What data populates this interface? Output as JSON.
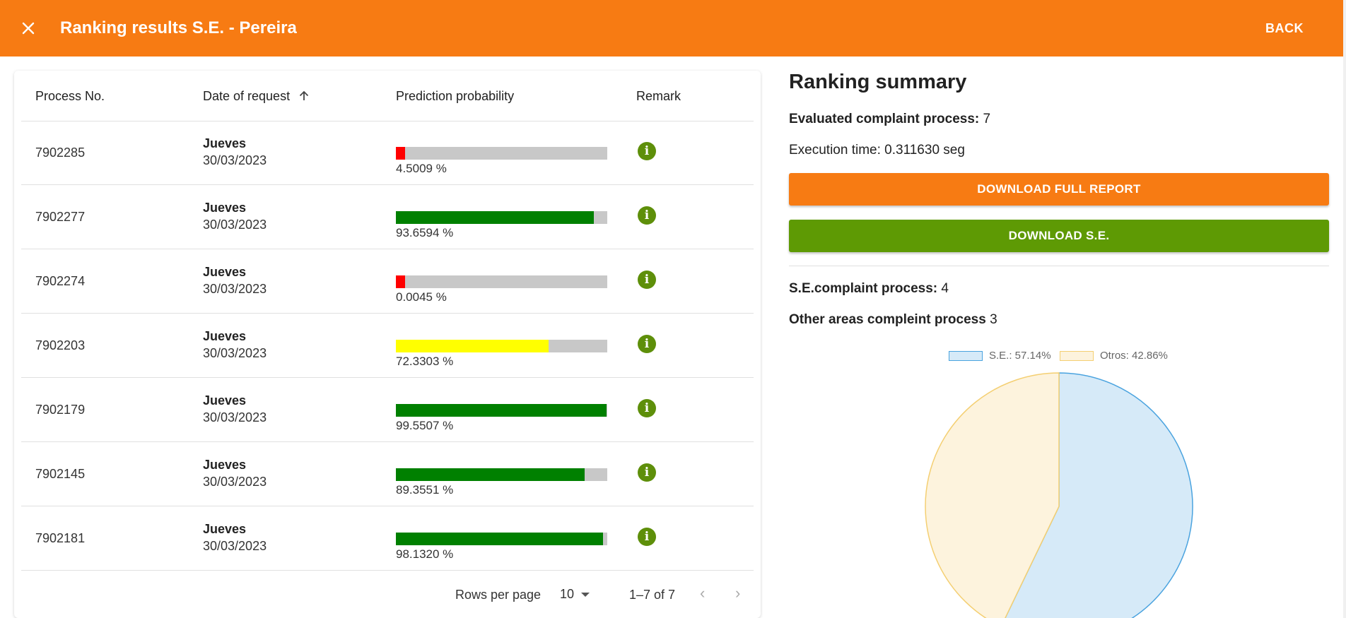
{
  "header": {
    "title": "Ranking results S.E. - Pereira",
    "back_label": "BACK"
  },
  "table": {
    "columns": [
      "Process No.",
      "Date of request",
      "Prediction probability",
      "Remark"
    ],
    "rows": [
      {
        "process": "7902285",
        "day": "Jueves",
        "date": "30/03/2023",
        "percent": "4.5009 %",
        "value": 4.5009,
        "color": "#ff0000"
      },
      {
        "process": "7902277",
        "day": "Jueves",
        "date": "30/03/2023",
        "percent": "93.6594 %",
        "value": 93.6594,
        "color": "#008000"
      },
      {
        "process": "7902274",
        "day": "Jueves",
        "date": "30/03/2023",
        "percent": "0.0045 %",
        "value": 0.0045,
        "color": "#ff0000"
      },
      {
        "process": "7902203",
        "day": "Jueves",
        "date": "30/03/2023",
        "percent": "72.3303 %",
        "value": 72.3303,
        "color": "#ffff00"
      },
      {
        "process": "7902179",
        "day": "Jueves",
        "date": "30/03/2023",
        "percent": "99.5507 %",
        "value": 99.5507,
        "color": "#008000"
      },
      {
        "process": "7902145",
        "day": "Jueves",
        "date": "30/03/2023",
        "percent": "89.3551 %",
        "value": 89.3551,
        "color": "#008000"
      },
      {
        "process": "7902181",
        "day": "Jueves",
        "date": "30/03/2023",
        "percent": "98.1320 %",
        "value": 98.132,
        "color": "#008000"
      }
    ],
    "info_icon": "i",
    "footer": {
      "rows_per_page_label": "Rows per page",
      "rows_per_page_value": "10",
      "range": "1–7 of 7"
    }
  },
  "summary": {
    "title": "Ranking summary",
    "evaluated_label": "Evaluated complaint process:",
    "evaluated_value": "7",
    "execution_time": "Execution time: 0.311630 seg",
    "download_full_label": "DOWNLOAD FULL REPORT",
    "download_se_label": "DOWNLOAD S.E.",
    "se_label": "S.E.complaint process:",
    "se_value": "4",
    "other_label": "Other areas compleint process",
    "other_value": "3"
  },
  "colors": {
    "brand_orange": "#f77b13",
    "brand_green": "#5e9a04",
    "info_green": "#5e8f0a"
  },
  "chart_data": {
    "type": "pie",
    "slices": [
      {
        "label": "S.E.: 57.14%",
        "value": 57.14,
        "fill": "#d6eaf8",
        "stroke": "#4aa3df"
      },
      {
        "label": "Otros: 42.86%",
        "value": 42.86,
        "fill": "#fdf3dd",
        "stroke": "#f4cf72"
      }
    ],
    "legend_position": "top"
  }
}
